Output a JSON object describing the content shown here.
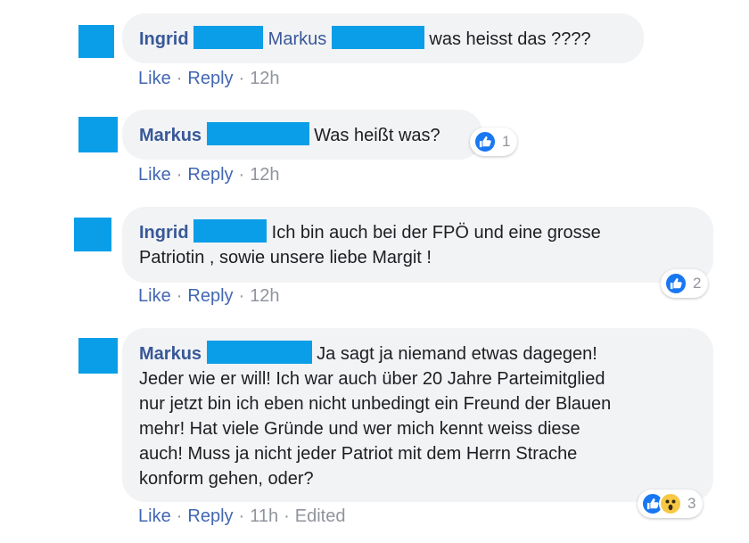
{
  "actions": {
    "like": "Like",
    "reply": "Reply",
    "separator": "·"
  },
  "comments": [
    {
      "author": "Ingrid",
      "mention": "Markus",
      "text": "was heisst das ????",
      "time": "12h",
      "edited": "",
      "reactions": null
    },
    {
      "author": "Markus",
      "mention": "",
      "text": "Was heißt was?",
      "time": "12h",
      "edited": "",
      "reactions": {
        "icons": [
          "like-icon"
        ],
        "count": "1"
      }
    },
    {
      "author": "Ingrid",
      "mention": "",
      "text_line1": "Ich bin auch bei der FPÖ und eine grosse",
      "text_line2": "Patriotin , sowie unsere liebe Margit !",
      "time": "12h",
      "edited": "",
      "reactions": {
        "icons": [
          "like-icon"
        ],
        "count": "2"
      }
    },
    {
      "author": "Markus",
      "mention": "",
      "text_line1": "Ja sagt ja niemand etwas dagegen!",
      "text_line2": "Jeder wie er will! Ich war auch über 20 Jahre Parteimitglied",
      "text_line3": "nur jetzt bin ich eben nicht unbedingt ein Freund der Blauen",
      "text_line4": "mehr! Hat viele Gründe und wer mich kennt weiss diese",
      "text_line5": "auch! Muss ja nicht jeder Patriot mit dem Herrn Strache",
      "text_line6": "konform gehen, oder?",
      "time": "11h",
      "edited": "Edited",
      "reactions": {
        "icons": [
          "like-icon",
          "wow-icon"
        ],
        "count": "3"
      }
    }
  ],
  "colors": {
    "redaction": "#0b9ee8",
    "author": "#385898",
    "link": "#4267b2",
    "meta": "#90949c",
    "bubble": "#f2f3f5",
    "like": "#1877f2"
  }
}
